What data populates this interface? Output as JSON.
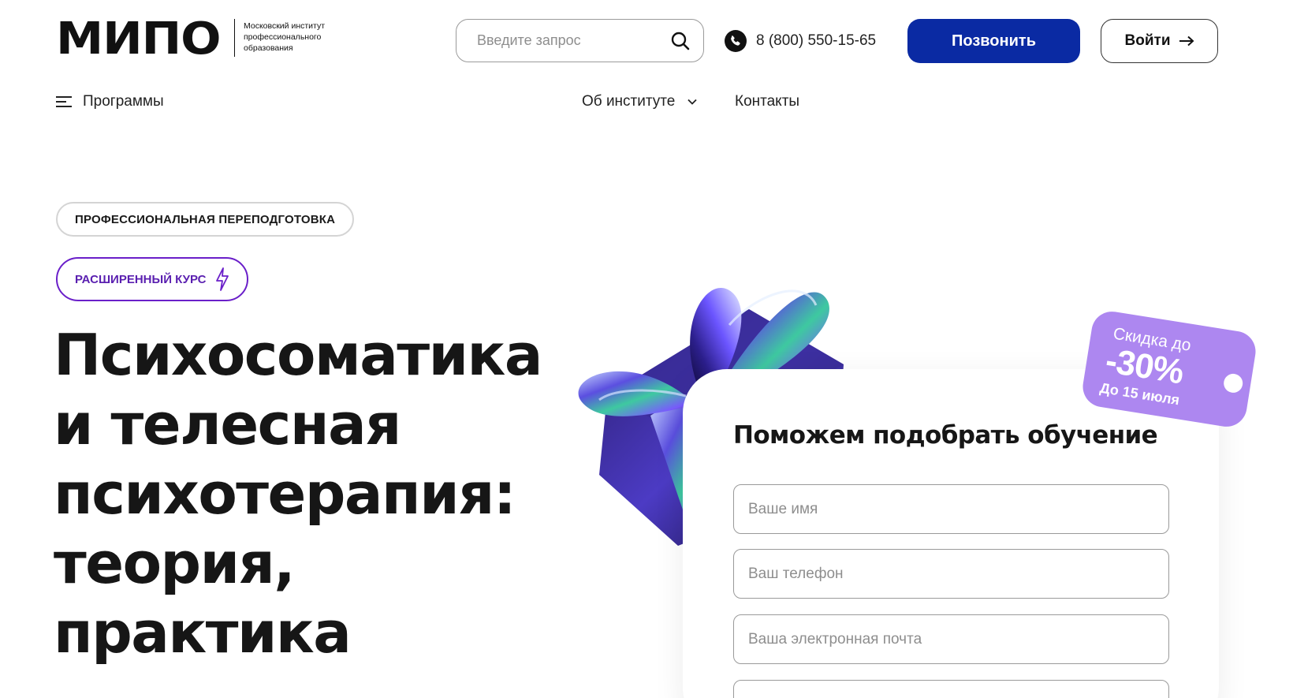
{
  "header": {
    "logo_text": "МИПО",
    "logo_subtitle_lines": [
      "Московский институт",
      "профессионального",
      "образования"
    ],
    "search_placeholder": "Введите запрос",
    "phone": "8 (800) 550-15-65",
    "call_button": "Позвонить",
    "login_button": "Войти",
    "colors": {
      "primary": "#0a2aa3",
      "accent_purple": "#6a1fc9",
      "discount": "#ad87f0"
    }
  },
  "nav": {
    "programs": "Программы",
    "about": "Об институте",
    "contacts": "Контакты"
  },
  "hero": {
    "tag_retraining": "ПРОФЕССИОНАЛЬНАЯ ПЕРЕПОДГОТОВКА",
    "tag_course": "РАСШИРЕННЫЙ КУРС",
    "title_lines": [
      "Психосоматика",
      "и телесная",
      "психотерапия:",
      "теория,",
      "практика"
    ]
  },
  "form": {
    "title": "Поможем подобрать обучение",
    "name_placeholder": "Ваше имя",
    "phone_placeholder": "Ваш телефон",
    "email_placeholder": "Ваша электронная почта"
  },
  "discount": {
    "line1": "Скидка до",
    "line2": "-30%",
    "line3": "До 15 июля"
  },
  "icons": [
    "search-icon",
    "phone-icon",
    "arrow-right-icon",
    "menu-icon",
    "chevron-down-icon",
    "lightning-icon",
    "gift-decoration"
  ]
}
